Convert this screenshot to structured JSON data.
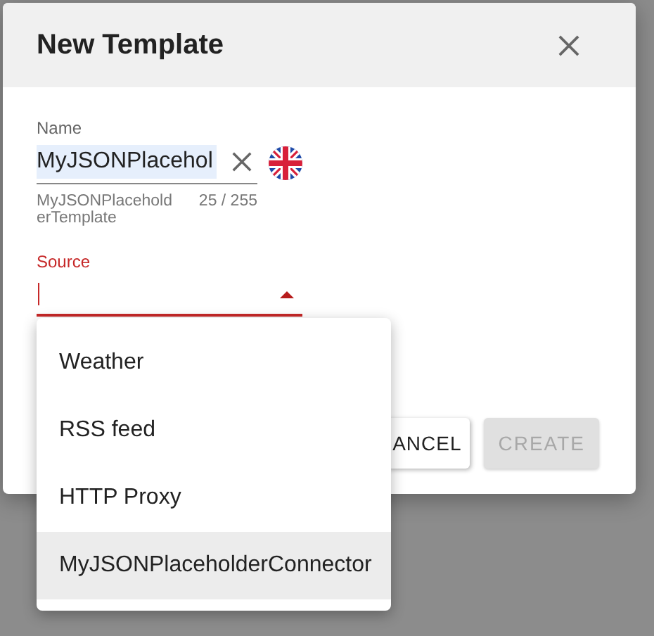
{
  "dialog": {
    "title": "New Template",
    "name_field": {
      "label": "Name",
      "value": "MyJSONPlacehol",
      "hint": "MyJSONPlaceholderTemplate",
      "counter": "25 / 255"
    },
    "source_field": {
      "label": "Source",
      "focused": true
    },
    "buttons": [
      {
        "label": "ANCEL",
        "disabled": false
      },
      {
        "label": "CREATE",
        "disabled": true
      }
    ]
  },
  "source_menu": {
    "items": [
      {
        "label": "Weather",
        "selected": false
      },
      {
        "label": "RSS feed",
        "selected": false
      },
      {
        "label": "HTTP Proxy",
        "selected": false
      },
      {
        "label": "MyJSONPlaceholderConnector",
        "selected": true
      }
    ]
  }
}
